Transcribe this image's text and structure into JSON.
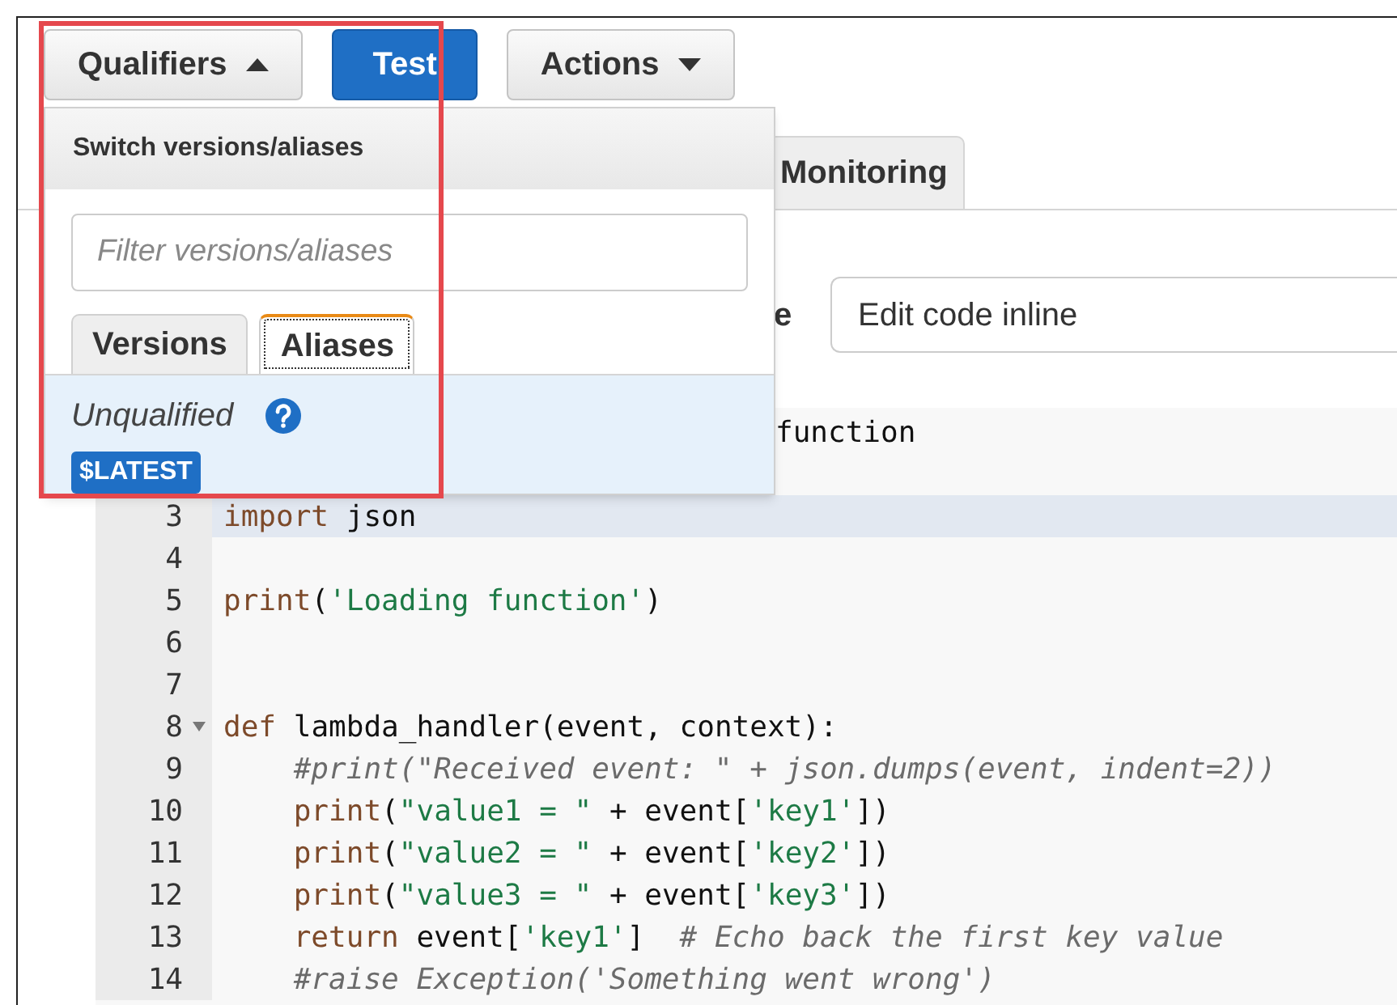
{
  "toolbar": {
    "buttons": [
      {
        "label": "Qualifiers",
        "kind": "caret-up"
      },
      {
        "label": "Test",
        "kind": "primary"
      },
      {
        "label": "Actions",
        "kind": "caret-down"
      }
    ]
  },
  "qualifiers_menu": {
    "title": "Switch versions/aliases",
    "filter": {
      "placeholder": "Filter versions/aliases"
    },
    "tabs": [
      {
        "label": "Versions",
        "selected": false
      },
      {
        "label": "Aliases",
        "selected": true
      }
    ],
    "item": {
      "label": "Unqualified",
      "badge": "$LATEST",
      "selected": true
    }
  },
  "tabs": [
    {
      "label": "Monitoring",
      "selected": false
    }
  ],
  "code_entry": {
    "label": "e",
    "value": "Edit code inline"
  },
  "editor": {
    "covered_line": {
      "text": "function"
    },
    "lines": [
      {
        "number": "3",
        "active": true,
        "foldable": false,
        "tokens": [
          {
            "kind": "keyword",
            "text": "import"
          },
          {
            "kind": "plain",
            "text": " json"
          }
        ]
      },
      {
        "number": "4",
        "active": false,
        "foldable": false
      },
      {
        "number": "5",
        "active": false,
        "foldable": false,
        "tokens": [
          {
            "kind": "keyword",
            "text": "print"
          },
          {
            "kind": "plain",
            "text": "("
          },
          {
            "kind": "string",
            "text": "'Loading function'"
          },
          {
            "kind": "plain",
            "text": ")"
          }
        ]
      },
      {
        "number": "6",
        "active": false,
        "foldable": false
      },
      {
        "number": "7",
        "active": false,
        "foldable": false
      },
      {
        "number": "8",
        "active": false,
        "foldable": true,
        "tokens": [
          {
            "kind": "keyword",
            "text": "def"
          },
          {
            "kind": "plain",
            "text": " lambda_handler(event, context):"
          }
        ]
      },
      {
        "number": "9",
        "active": false,
        "foldable": false,
        "tokens": [
          {
            "kind": "comment",
            "text": "    #print(\"Received event: \" + json.dumps(event, indent=2))"
          }
        ]
      },
      {
        "number": "10",
        "active": false,
        "foldable": false,
        "tokens": [
          {
            "kind": "keyword",
            "text": "    print"
          },
          {
            "kind": "plain",
            "text": "("
          },
          {
            "kind": "string",
            "text": "\"value1 = \""
          },
          {
            "kind": "plain",
            "text": " + event["
          },
          {
            "kind": "string",
            "text": "'key1'"
          },
          {
            "kind": "plain",
            "text": "])"
          }
        ]
      },
      {
        "number": "11",
        "active": false,
        "foldable": false,
        "tokens": [
          {
            "kind": "keyword",
            "text": "    print"
          },
          {
            "kind": "plain",
            "text": "("
          },
          {
            "kind": "string",
            "text": "\"value2 = \""
          },
          {
            "kind": "plain",
            "text": " + event["
          },
          {
            "kind": "string",
            "text": "'key2'"
          },
          {
            "kind": "plain",
            "text": "])"
          }
        ]
      },
      {
        "number": "12",
        "active": false,
        "foldable": false,
        "tokens": [
          {
            "kind": "keyword",
            "text": "    print"
          },
          {
            "kind": "plain",
            "text": "("
          },
          {
            "kind": "string",
            "text": "\"value3 = \""
          },
          {
            "kind": "plain",
            "text": " + event["
          },
          {
            "kind": "string",
            "text": "'key3'"
          },
          {
            "kind": "plain",
            "text": "])"
          }
        ]
      },
      {
        "number": "13",
        "active": false,
        "foldable": false,
        "tokens": [
          {
            "kind": "keyword",
            "text": "    return"
          },
          {
            "kind": "plain",
            "text": " event["
          },
          {
            "kind": "string",
            "text": "'key1'"
          },
          {
            "kind": "plain",
            "text": "]  "
          },
          {
            "kind": "comment",
            "text": "# Echo back the first key value"
          }
        ]
      },
      {
        "number": "14",
        "active": false,
        "foldable": false,
        "tokens": [
          {
            "kind": "comment",
            "text": "    #raise Exception('Something went wrong')"
          }
        ]
      }
    ]
  }
}
